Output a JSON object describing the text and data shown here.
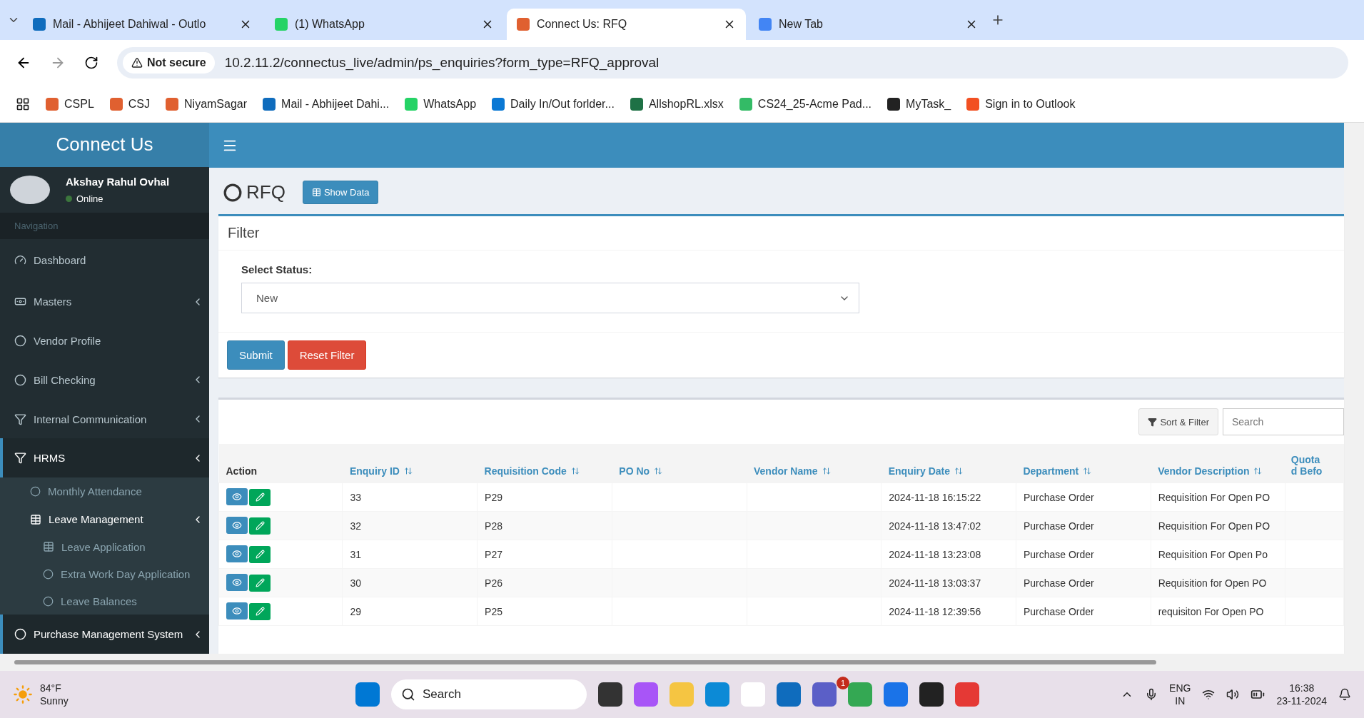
{
  "browser": {
    "tabs": [
      {
        "title": "Mail - Abhijeet Dahiwal - Outlo",
        "selected": false
      },
      {
        "title": "(1) WhatsApp",
        "selected": false
      },
      {
        "title": "Connect Us: RFQ",
        "selected": true
      },
      {
        "title": "New Tab",
        "selected": false
      }
    ],
    "security": "Not secure",
    "url": "10.2.11.2/connectus_live/admin/ps_enquiries?form_type=RFQ_approval",
    "bookmarks": [
      "CSPL",
      "CSJ",
      "NiyamSagar",
      "Mail - Abhijeet Dahi...",
      "WhatsApp",
      "Daily In/Out forlder...",
      "AllshopRL.xlsx",
      "CS24_25-Acme Pad...",
      "MyTask_",
      "Sign in to Outlook"
    ]
  },
  "sidebar": {
    "brand": "Connect Us",
    "user": {
      "name": "Akshay Rahul Ovhal",
      "status": "Online"
    },
    "section": "Navigation",
    "items": [
      {
        "label": "Dashboard",
        "expandable": false,
        "selected": false
      },
      {
        "label": "Masters",
        "expandable": true,
        "selected": false
      },
      {
        "label": "Vendor Profile",
        "expandable": false,
        "selected": false
      },
      {
        "label": "Bill Checking",
        "expandable": true,
        "selected": false
      },
      {
        "label": "Internal Communication",
        "expandable": true,
        "selected": false
      },
      {
        "label": "HRMS",
        "expandable": true,
        "selected": true,
        "children": [
          {
            "label": "Monthly Attendance",
            "expandable": false
          },
          {
            "label": "Leave Management",
            "expandable": true,
            "children": [
              {
                "label": "Leave Application"
              },
              {
                "label": "Extra Work Day Application"
              },
              {
                "label": "Leave Balances"
              }
            ]
          }
        ]
      },
      {
        "label": "Purchase Management System",
        "expandable": true,
        "selected": true
      }
    ]
  },
  "page": {
    "title": "RFQ",
    "show_data": "Show Data",
    "filter": {
      "title": "Filter",
      "label": "Select Status:",
      "value": "New",
      "submit": "Submit",
      "reset": "Reset Filter"
    },
    "table": {
      "sort_filter": "Sort & Filter",
      "search_placeholder": "Search",
      "columns": [
        "Action",
        "Enquiry ID",
        "Requisition Code",
        "PO No",
        "Vendor Name",
        "Enquiry Date",
        "Department",
        "Vendor Description",
        "Quota\nd Befo"
      ],
      "rows": [
        {
          "id": "33",
          "code": "P29",
          "po": "",
          "vendor": "",
          "date": "2024-11-18 16:15:22",
          "department": "Purchase Order",
          "description": "Requisition For Open PO"
        },
        {
          "id": "32",
          "code": "P28",
          "po": "",
          "vendor": "",
          "date": "2024-11-18 13:47:02",
          "department": "Purchase Order",
          "description": "Requisition For Open PO"
        },
        {
          "id": "31",
          "code": "P27",
          "po": "",
          "vendor": "",
          "date": "2024-11-18 13:23:08",
          "department": "Purchase Order",
          "description": "Requisition For Open Po"
        },
        {
          "id": "30",
          "code": "P26",
          "po": "",
          "vendor": "",
          "date": "2024-11-18 13:03:37",
          "department": "Purchase Order",
          "description": "Requisition for Open PO"
        },
        {
          "id": "29",
          "code": "P25",
          "po": "",
          "vendor": "",
          "date": "2024-11-18 12:39:56",
          "department": "Purchase Order",
          "description": "requisiton For Open PO"
        }
      ]
    }
  },
  "taskbar": {
    "temperature": "84°F",
    "weather": "Sunny",
    "search": "Search",
    "teams_badge": "1",
    "language": "ENG",
    "region": "IN",
    "time": "16:38",
    "date": "23-11-2024"
  }
}
